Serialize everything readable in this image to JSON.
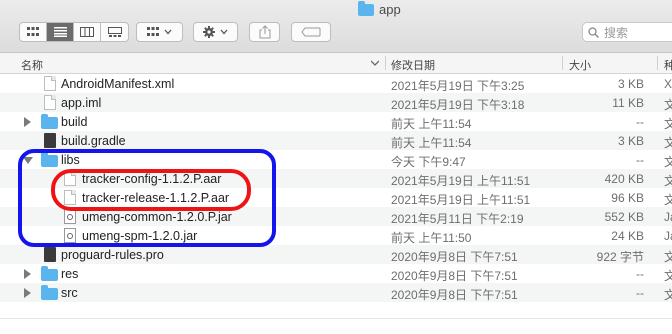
{
  "window": {
    "title": "app"
  },
  "toolbar": {
    "view_modes": [
      "icon-view",
      "list-view",
      "column-view",
      "gallery-view"
    ],
    "active_view": "list-view",
    "search_placeholder": "搜索"
  },
  "columns": {
    "name": "名称",
    "date": "修改日期",
    "size": "大小",
    "kind": "种"
  },
  "rows": [
    {
      "name": "AndroidManifest.xml",
      "date": "2021年5月19日 下午3:25",
      "size": "3 KB",
      "kind": "X",
      "icon": "document",
      "depth": 0,
      "expand": "none"
    },
    {
      "name": "app.iml",
      "date": "2021年5月19日 下午3:18",
      "size": "11 KB",
      "kind": "文",
      "icon": "document",
      "depth": 0,
      "expand": "none"
    },
    {
      "name": "build",
      "date": "前天 上午11:54",
      "size": "--",
      "kind": "文",
      "icon": "folder",
      "depth": 0,
      "expand": "collapsed"
    },
    {
      "name": "build.gradle",
      "date": "前天 上午11:54",
      "size": "3 KB",
      "kind": "文",
      "icon": "dark",
      "depth": 0,
      "expand": "none"
    },
    {
      "name": "libs",
      "date": "今天 下午9:47",
      "size": "--",
      "kind": "文",
      "icon": "folder",
      "depth": 0,
      "expand": "expanded"
    },
    {
      "name": "tracker-config-1.1.2.P.aar",
      "date": "2021年5月19日 上午11:51",
      "size": "420 KB",
      "kind": "文",
      "icon": "document",
      "depth": 1,
      "expand": "none"
    },
    {
      "name": "tracker-release-1.1.2.P.aar",
      "date": "2021年5月19日 上午11:51",
      "size": "96 KB",
      "kind": "文",
      "icon": "document",
      "depth": 1,
      "expand": "none"
    },
    {
      "name": "umeng-common-1.2.0.P.jar",
      "date": "2021年5月11日 下午2:19",
      "size": "552 KB",
      "kind": "Ja",
      "icon": "jar",
      "depth": 1,
      "expand": "none"
    },
    {
      "name": "umeng-spm-1.2.0.jar",
      "date": "前天 上午11:50",
      "size": "24 KB",
      "kind": "Ja",
      "icon": "jar",
      "depth": 1,
      "expand": "none"
    },
    {
      "name": "proguard-rules.pro",
      "date": "2020年9月8日 下午7:51",
      "size": "922 字节",
      "kind": "文",
      "icon": "dark",
      "depth": 0,
      "expand": "none"
    },
    {
      "name": "res",
      "date": "2020年9月8日 下午7:51",
      "size": "--",
      "kind": "文",
      "icon": "folder",
      "depth": 0,
      "expand": "collapsed"
    },
    {
      "name": "src",
      "date": "2020年9月8日 下午7:51",
      "size": "--",
      "kind": "文",
      "icon": "folder",
      "depth": 0,
      "expand": "collapsed"
    }
  ],
  "colors": {
    "folder": "#5ab4ee",
    "highlight_blue": "#1414ee",
    "highlight_red": "#ee1414"
  }
}
